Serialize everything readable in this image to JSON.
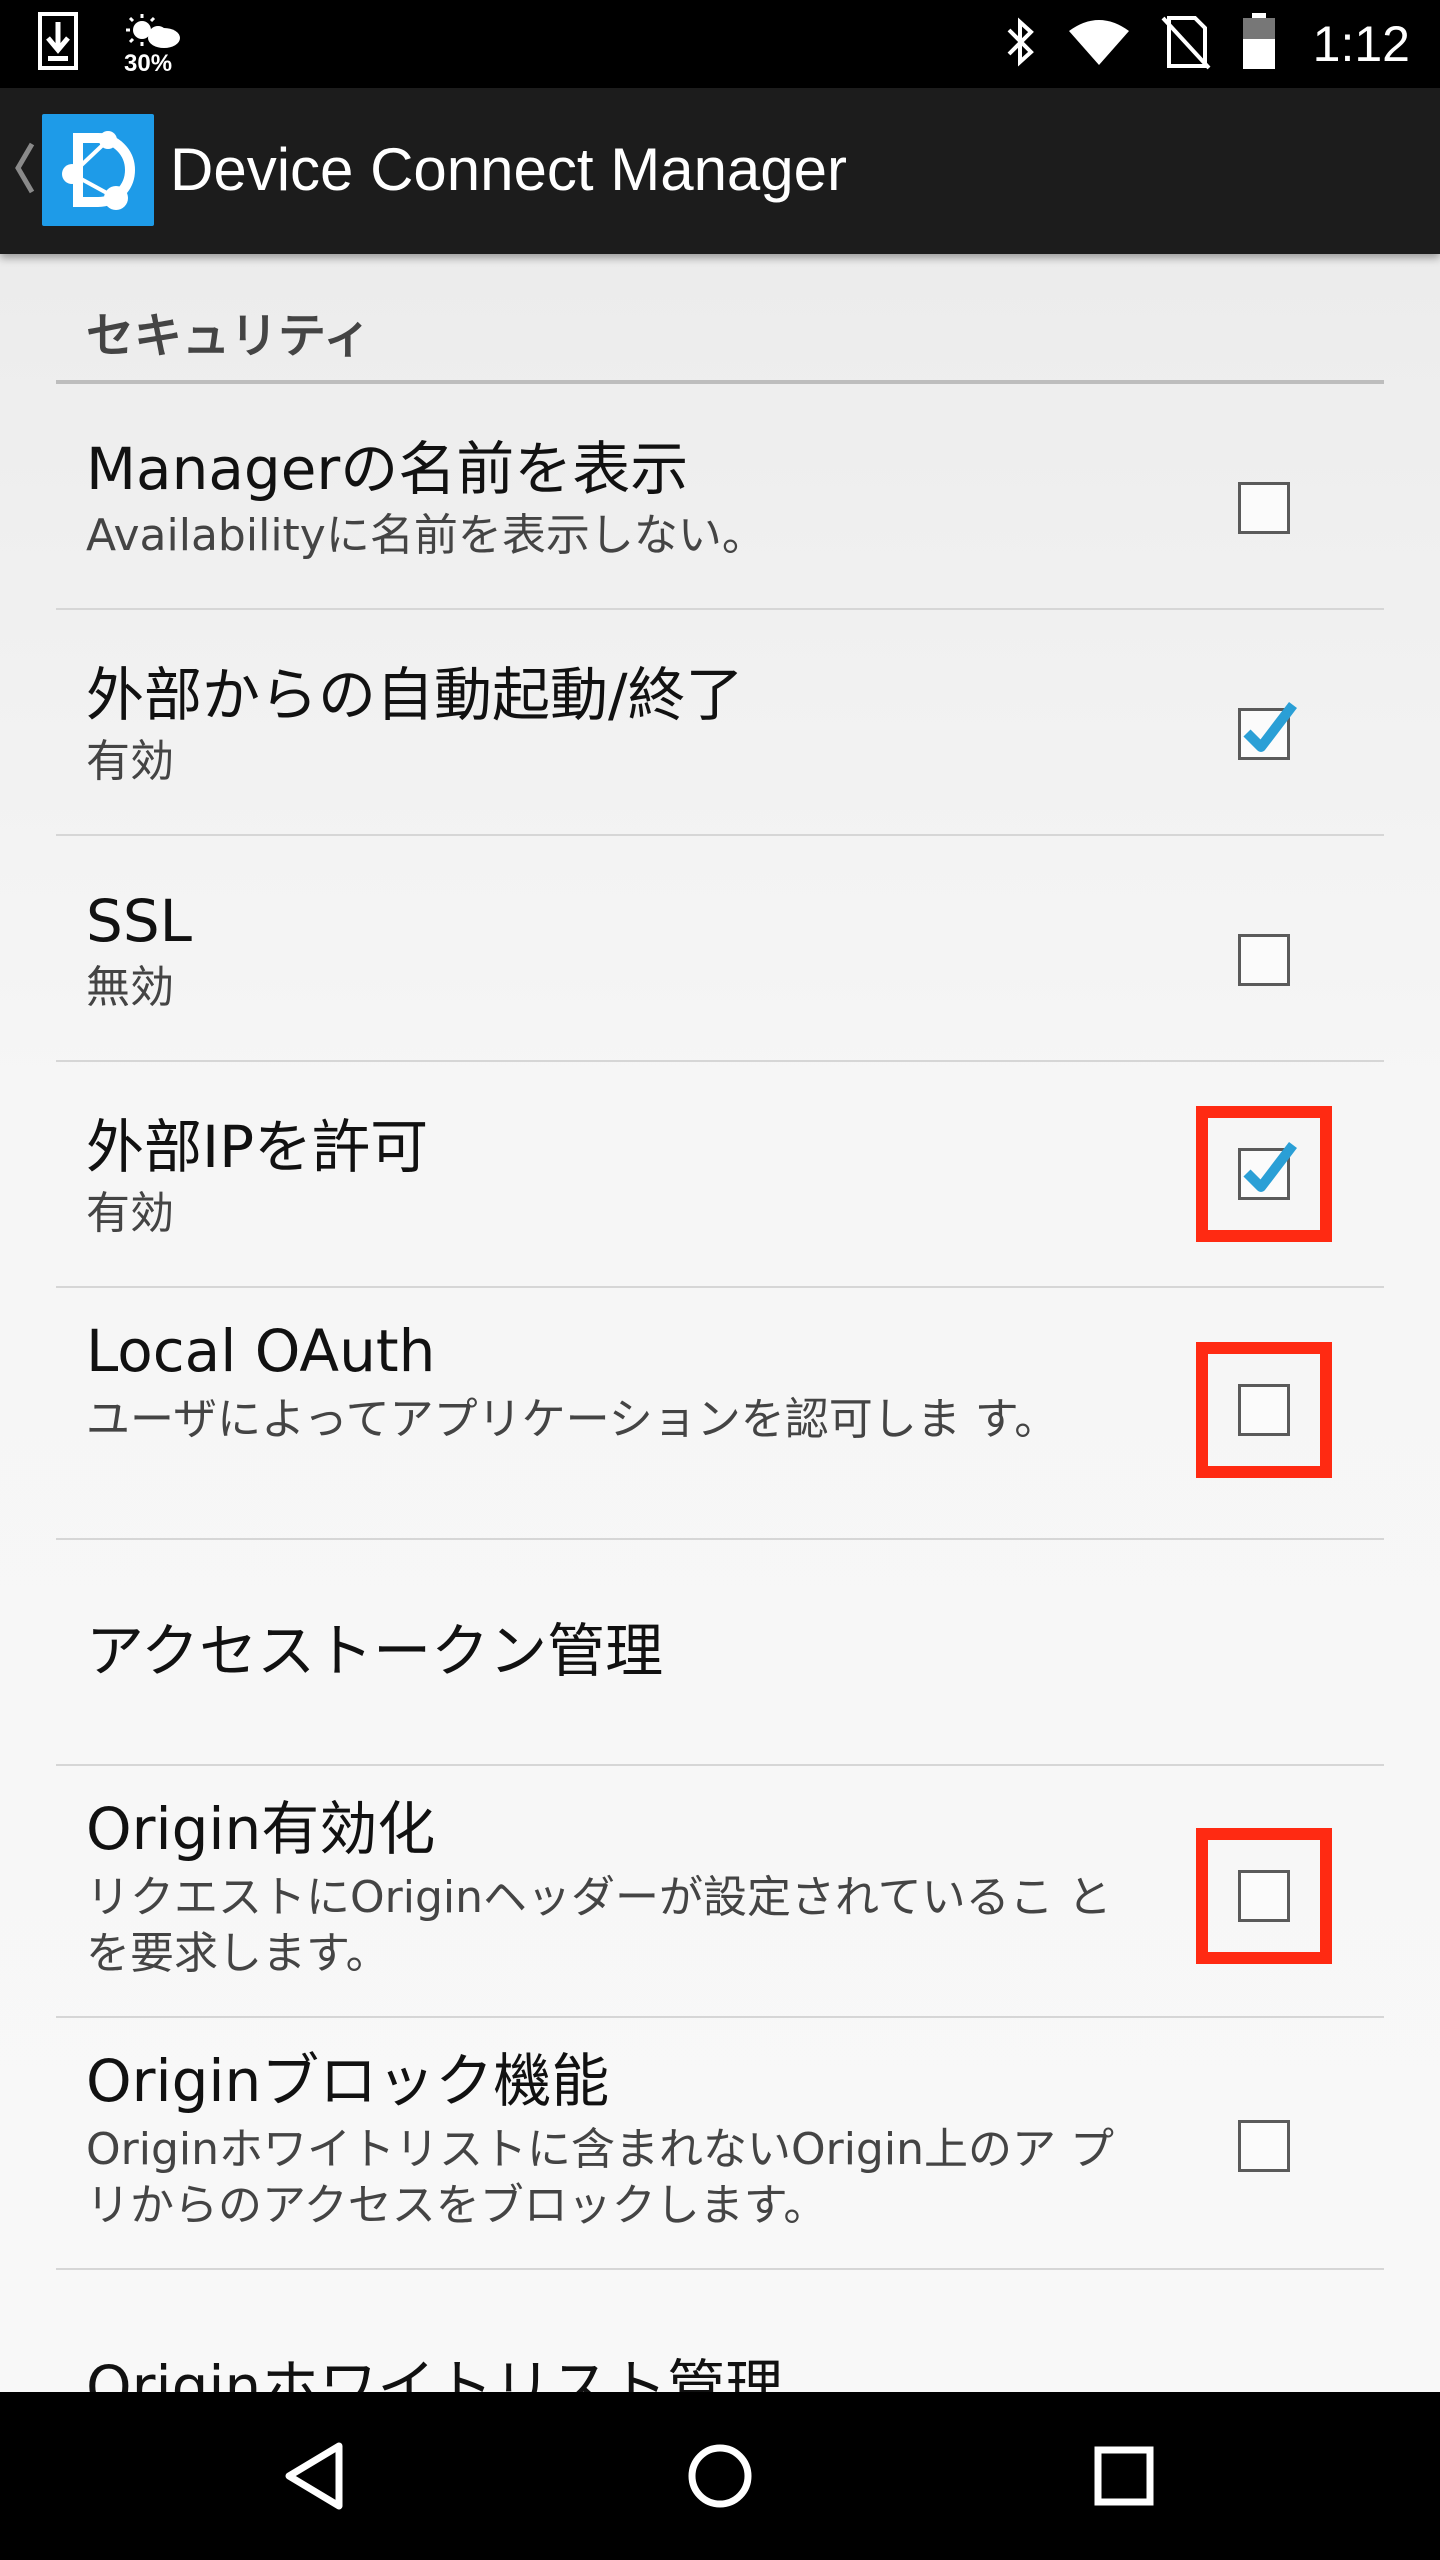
{
  "status_bar": {
    "weather_percent": "30%",
    "time": "1:12",
    "icons": [
      "download-icon",
      "weather-icon",
      "bluetooth-icon",
      "wifi-icon",
      "no-sim-icon",
      "battery-icon"
    ]
  },
  "action_bar": {
    "title": "Device Connect Manager"
  },
  "settings": {
    "category": "セキュリティ",
    "items": [
      {
        "title": "Managerの名前を表示",
        "summary": "Availabilityに名前を表示しない。",
        "checked": false,
        "highlighted": false
      },
      {
        "title": "外部からの自動起動/終了",
        "summary": "有効",
        "checked": true,
        "highlighted": false
      },
      {
        "title": "SSL",
        "summary": "無効",
        "checked": false,
        "highlighted": false
      },
      {
        "title": "外部IPを許可",
        "summary": "有効",
        "checked": true,
        "highlighted": true
      },
      {
        "title": "Local OAuth",
        "summary": "ユーザによってアプリケーションを認可しま す。",
        "checked": false,
        "highlighted": true
      },
      {
        "title": "アクセストークン管理"
      },
      {
        "title": "Origin有効化",
        "summary": "リクエストにOriginヘッダーが設定されているこ とを要求します。",
        "checked": false,
        "highlighted": true
      },
      {
        "title": "Originブロック機能",
        "summary": "Originホワイトリストに含まれないOrigin上のア プリからのアクセスをブロックします。",
        "checked": false,
        "highlighted": false
      },
      {
        "title": "Originホワイトリスト管理"
      }
    ]
  },
  "colors": {
    "highlight": "#ff2a12",
    "checkmark": "#2a9fd6",
    "logo": "#1e9be8"
  }
}
